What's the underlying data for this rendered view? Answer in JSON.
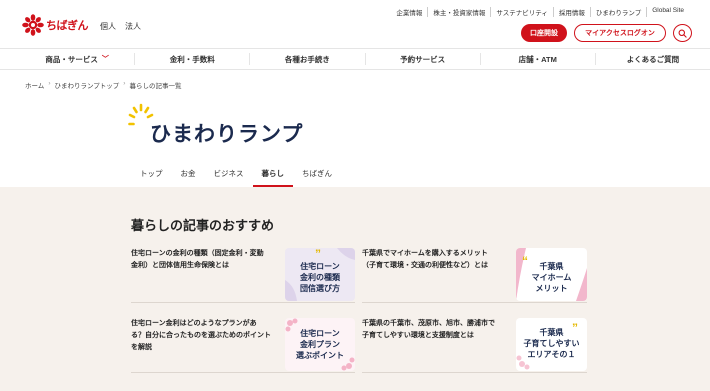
{
  "header": {
    "logo_text": "ちばぎん",
    "segments": [
      "個人",
      "法人"
    ],
    "top_links": [
      "企業情報",
      "株主・投資家情報",
      "サステナビリティ",
      "採用情報",
      "ひまわりランプ",
      "Global Site"
    ],
    "open_account": "口座開設",
    "access_login": "マイアクセスログオン"
  },
  "gnav": {
    "items": [
      "商品・サービス",
      "金利・手数料",
      "各種お手続き",
      "予約サービス",
      "店舗・ATM",
      "よくあるご質問"
    ],
    "caret": "﹀"
  },
  "breadcrumb": [
    "ホーム",
    "ひまわりランプトップ",
    "暮らしの記事一覧"
  ],
  "brand": {
    "title": "ひまわりランプ"
  },
  "subtabs": [
    "トップ",
    "お金",
    "ビジネス",
    "暮らし",
    "ちばぎん"
  ],
  "section": {
    "title": "暮らしの記事のおすすめ"
  },
  "articles": [
    {
      "title_lines": [
        "住宅ローンの金利の種類（固定金利・変動",
        "金利）と団体信用生命保険とは"
      ],
      "thumb_lines": [
        "住宅ローン",
        "金利の種類",
        "団信選び方"
      ]
    },
    {
      "title_lines": [
        "千葉県でマイホームを購入するメリット",
        "（子育て環境・交通の利便性など）とは"
      ],
      "thumb_lines": [
        "千葉県",
        "マイホーム",
        "メリット"
      ]
    },
    {
      "title_lines": [
        "住宅ローン金利はどのようなプランがあ",
        "る？自分に合ったものを選ぶためのポイント",
        "を解説"
      ],
      "thumb_lines": [
        "住宅ローン",
        "金利プラン",
        "選ぶポイント"
      ]
    },
    {
      "title_lines": [
        "千葉県の千葉市、茂原市、旭市、勝浦市で",
        "子育てしやすい環境と支援制度とは"
      ],
      "thumb_lines": [
        "千葉県",
        "子育てしやすい",
        "エリアその１"
      ]
    }
  ],
  "colors": {
    "brand_red": "#d0121b",
    "navy": "#1b2a4e",
    "beige": "#f6f1ec"
  }
}
